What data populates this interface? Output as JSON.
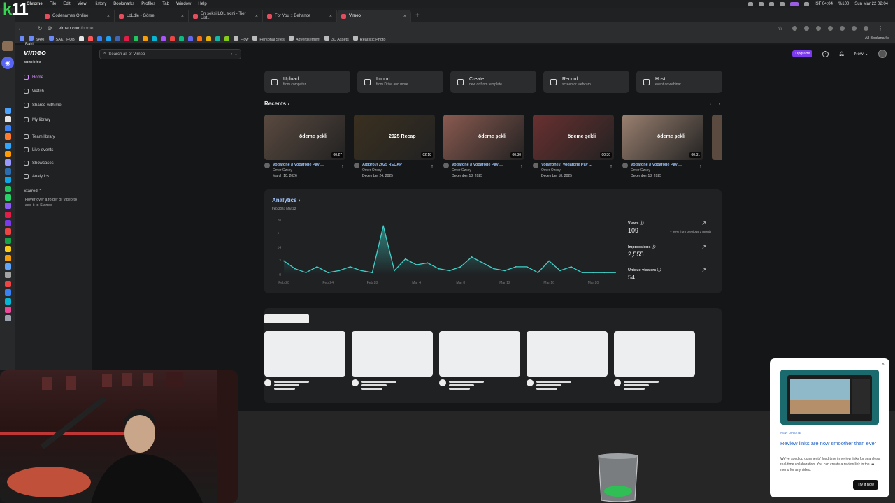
{
  "os_menubar": {
    "menus": [
      "Chrome",
      "File",
      "Edit",
      "View",
      "History",
      "Bookmarks",
      "Profiles",
      "Tab",
      "Window",
      "Help"
    ],
    "status_text": [
      "IST 04:04",
      "%100",
      "Sun Mar 22  02:04"
    ]
  },
  "overlay_logo": {
    "k": "k",
    "num": "11"
  },
  "browser": {
    "tabs": [
      {
        "label": "Codenames Online",
        "active": false
      },
      {
        "label": "LoLdle - Görsel",
        "active": false
      },
      {
        "label": "En seksi LOL skini - Tier List...",
        "active": false
      },
      {
        "label": "For You :: Behance",
        "active": false
      },
      {
        "label": "Vimeo",
        "active": true
      }
    ],
    "new_tab": "+",
    "url_host": "vimeo.com",
    "url_path": "/home",
    "bookmarks": [
      "SAKI",
      "SAKI_HUB",
      "Flow",
      "Personal Sites",
      "Advertisement",
      "3D Assets",
      "Realistic Photo"
    ],
    "all_bookmarks": "All Bookmarks"
  },
  "dock": {
    "user_label": "Baki"
  },
  "sidebar": {
    "logo": "vimeo",
    "team": "smertries",
    "items": [
      {
        "label": "Home",
        "active": true
      },
      {
        "label": "Watch",
        "active": false
      },
      {
        "label": "Shared with me",
        "active": false
      },
      {
        "label": "My library",
        "active": false
      },
      {
        "label": "Team library",
        "active": false
      },
      {
        "label": "Live events",
        "active": false
      },
      {
        "label": "Showcases",
        "active": false
      },
      {
        "label": "Analytics",
        "active": false
      }
    ],
    "starred_title": "Starred",
    "starred_hint": "Hover over a folder or video to add it to Starred"
  },
  "header": {
    "search_placeholder": "Search all of Vimeo",
    "upgrade": "Upgrade",
    "new_label": "New"
  },
  "actions": [
    {
      "title": "Upload",
      "sub": "from computer",
      "icon": "upload-icon"
    },
    {
      "title": "Import",
      "sub": "from Drive and more",
      "icon": "import-icon"
    },
    {
      "title": "Create",
      "sub": "new or from template",
      "icon": "create-icon"
    },
    {
      "title": "Record",
      "sub": "screen or webcam",
      "icon": "record-icon"
    },
    {
      "title": "Host",
      "sub": "event or webinar",
      "icon": "host-icon"
    }
  ],
  "recents": {
    "title": "Recents",
    "videos": [
      {
        "title": "Vodafone // Vodafone Pay ...",
        "owner": "Omer Ozsoy",
        "date": "March 10, 2026",
        "duration": "00:27",
        "overlay": "ödeme şekli",
        "color": "#5a4a40"
      },
      {
        "title": "Algbro // 2025 RECAP",
        "owner": "Omer Ozsoy",
        "date": "December 24, 2025",
        "duration": "02:18",
        "overlay": "2025 Recap",
        "color": "#3a3020"
      },
      {
        "title": "Vodafone // Vodafone Pay ...",
        "owner": "Omer Ozsoy",
        "date": "December 18, 2025",
        "duration": "00:30",
        "overlay": "ödeme şekli",
        "color": "#8a5a50"
      },
      {
        "title": "Vodafone // Vodafone Pay ...",
        "owner": "Omer Ozsoy",
        "date": "December 18, 2025",
        "duration": "00:30",
        "overlay": "ödeme şekli",
        "color": "#6a3030"
      },
      {
        "title": "Vodafone // Vodafone Pay ...",
        "owner": "Omer Ozsoy",
        "date": "December 18, 2025",
        "duration": "00:31",
        "overlay": "ödeme şekli",
        "color": "#9a8070"
      }
    ]
  },
  "analytics": {
    "title": "Analytics",
    "range": "Feb 20 to Mar 22",
    "metrics": [
      {
        "label": "Views",
        "value": "109",
        "note": "+ 20% from previous 1 month"
      },
      {
        "label": "Impressions",
        "value": "2,555",
        "note": ""
      },
      {
        "label": "Unique viewers",
        "value": "54",
        "note": ""
      }
    ],
    "accent": "#3fd1c9"
  },
  "chart_data": {
    "type": "area",
    "x": [
      "Feb 20",
      "Feb 21",
      "Feb 22",
      "Feb 23",
      "Feb 24",
      "Feb 25",
      "Feb 26",
      "Feb 27",
      "Feb 28",
      "Mar 1",
      "Mar 2",
      "Mar 3",
      "Mar 4",
      "Mar 5",
      "Mar 6",
      "Mar 7",
      "Mar 8",
      "Mar 9",
      "Mar 10",
      "Mar 11",
      "Mar 12",
      "Mar 13",
      "Mar 14",
      "Mar 15",
      "Mar 16",
      "Mar 17",
      "Mar 18",
      "Mar 19",
      "Mar 20",
      "Mar 21",
      "Mar 22"
    ],
    "series": [
      {
        "values": [
          7,
          3,
          1,
          4,
          1,
          2,
          4,
          2,
          1,
          25,
          2,
          8,
          5,
          6,
          3,
          2,
          4,
          9,
          6,
          3,
          2,
          4,
          4,
          1,
          7,
          2,
          4,
          1,
          1,
          1,
          1
        ]
      }
    ],
    "xticks": [
      "Feb 20",
      "Feb 24",
      "Feb 28",
      "Mar 4",
      "Mar 8",
      "Mar 12",
      "Mar 16",
      "Mar 20"
    ],
    "yticks": [
      0,
      7,
      14,
      21,
      28
    ],
    "ylim": [
      0,
      28
    ]
  },
  "popup": {
    "tag": "NEW UPDATE",
    "title": "Review links are now smoother than ever",
    "body": "We've sped up comments' load time in review links for seamless, real-time collaboration. You can create a review link in the ••• menu for any video.",
    "button": "Try it now"
  }
}
